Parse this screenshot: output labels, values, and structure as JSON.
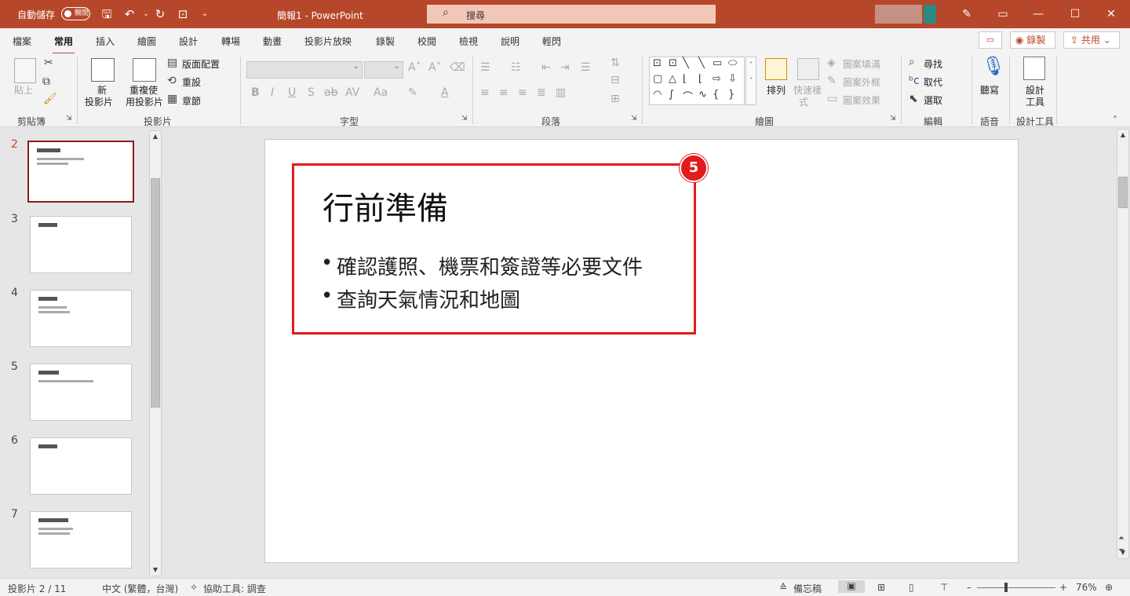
{
  "titlebar": {
    "autosave_label": "自動儲存",
    "autosave_toggle": "關閉",
    "doc_title": "簡報1 - PowerPoint",
    "search_placeholder": "搜尋",
    "bg_color": "#b7472a"
  },
  "tabs": [
    "檔案",
    "常用",
    "插入",
    "繪圖",
    "設計",
    "轉場",
    "動畫",
    "投影片放映",
    "錄製",
    "校閱",
    "檢視",
    "說明",
    "輕閃"
  ],
  "active_tab": "常用",
  "tab_right": {
    "record": "錄製",
    "share": "共用"
  },
  "ribbon": {
    "clipboard": {
      "paste": "貼上",
      "label": "剪貼簿"
    },
    "slides": {
      "new_slide_1": "新",
      "new_slide_2": "投影片",
      "reuse_1": "重複使",
      "reuse_2": "用投影片",
      "layout": "版面配置",
      "reset": "重設",
      "section": "章節",
      "label": "投影片"
    },
    "font": {
      "label": "字型",
      "bold": "B",
      "italic": "I",
      "underline": "U",
      "shadow": "S",
      "strike": "ab",
      "spacing": "AV",
      "case": "Aa",
      "font_color": "A"
    },
    "paragraph": {
      "label": "段落"
    },
    "drawing": {
      "arrange": "排列",
      "quick_styles_1": "快速樣",
      "quick_styles_2": "式",
      "shape_fill": "圖案填滿",
      "shape_outline": "圖案外框",
      "shape_effects": "圖案效果",
      "label": "繪圖"
    },
    "editing": {
      "find": "尋找",
      "replace": "取代",
      "select": "選取",
      "label": "編輯"
    },
    "voice": {
      "dictate": "聽寫",
      "label": "語音"
    },
    "designer": {
      "label_1": "設計",
      "label_2": "工具",
      "group_label": "設計工具"
    }
  },
  "thumbnails": [
    {
      "num": "2",
      "selected": true
    },
    {
      "num": "3",
      "selected": false
    },
    {
      "num": "4",
      "selected": false
    },
    {
      "num": "5",
      "selected": false
    },
    {
      "num": "6",
      "selected": false
    },
    {
      "num": "7",
      "selected": false
    }
  ],
  "slide": {
    "title": "行前準備",
    "bullets": [
      "確認護照、機票和簽證等必要文件",
      "查詢天氣情況和地圖"
    ],
    "callout_number": "5",
    "callout_color": "#e21b1b"
  },
  "status": {
    "slide_pos": "投影片 2 / 11",
    "language": "中文 (繁體，台灣)",
    "accessibility": "協助工具: 調查",
    "notes": "備忘稿",
    "zoom": "76%"
  }
}
